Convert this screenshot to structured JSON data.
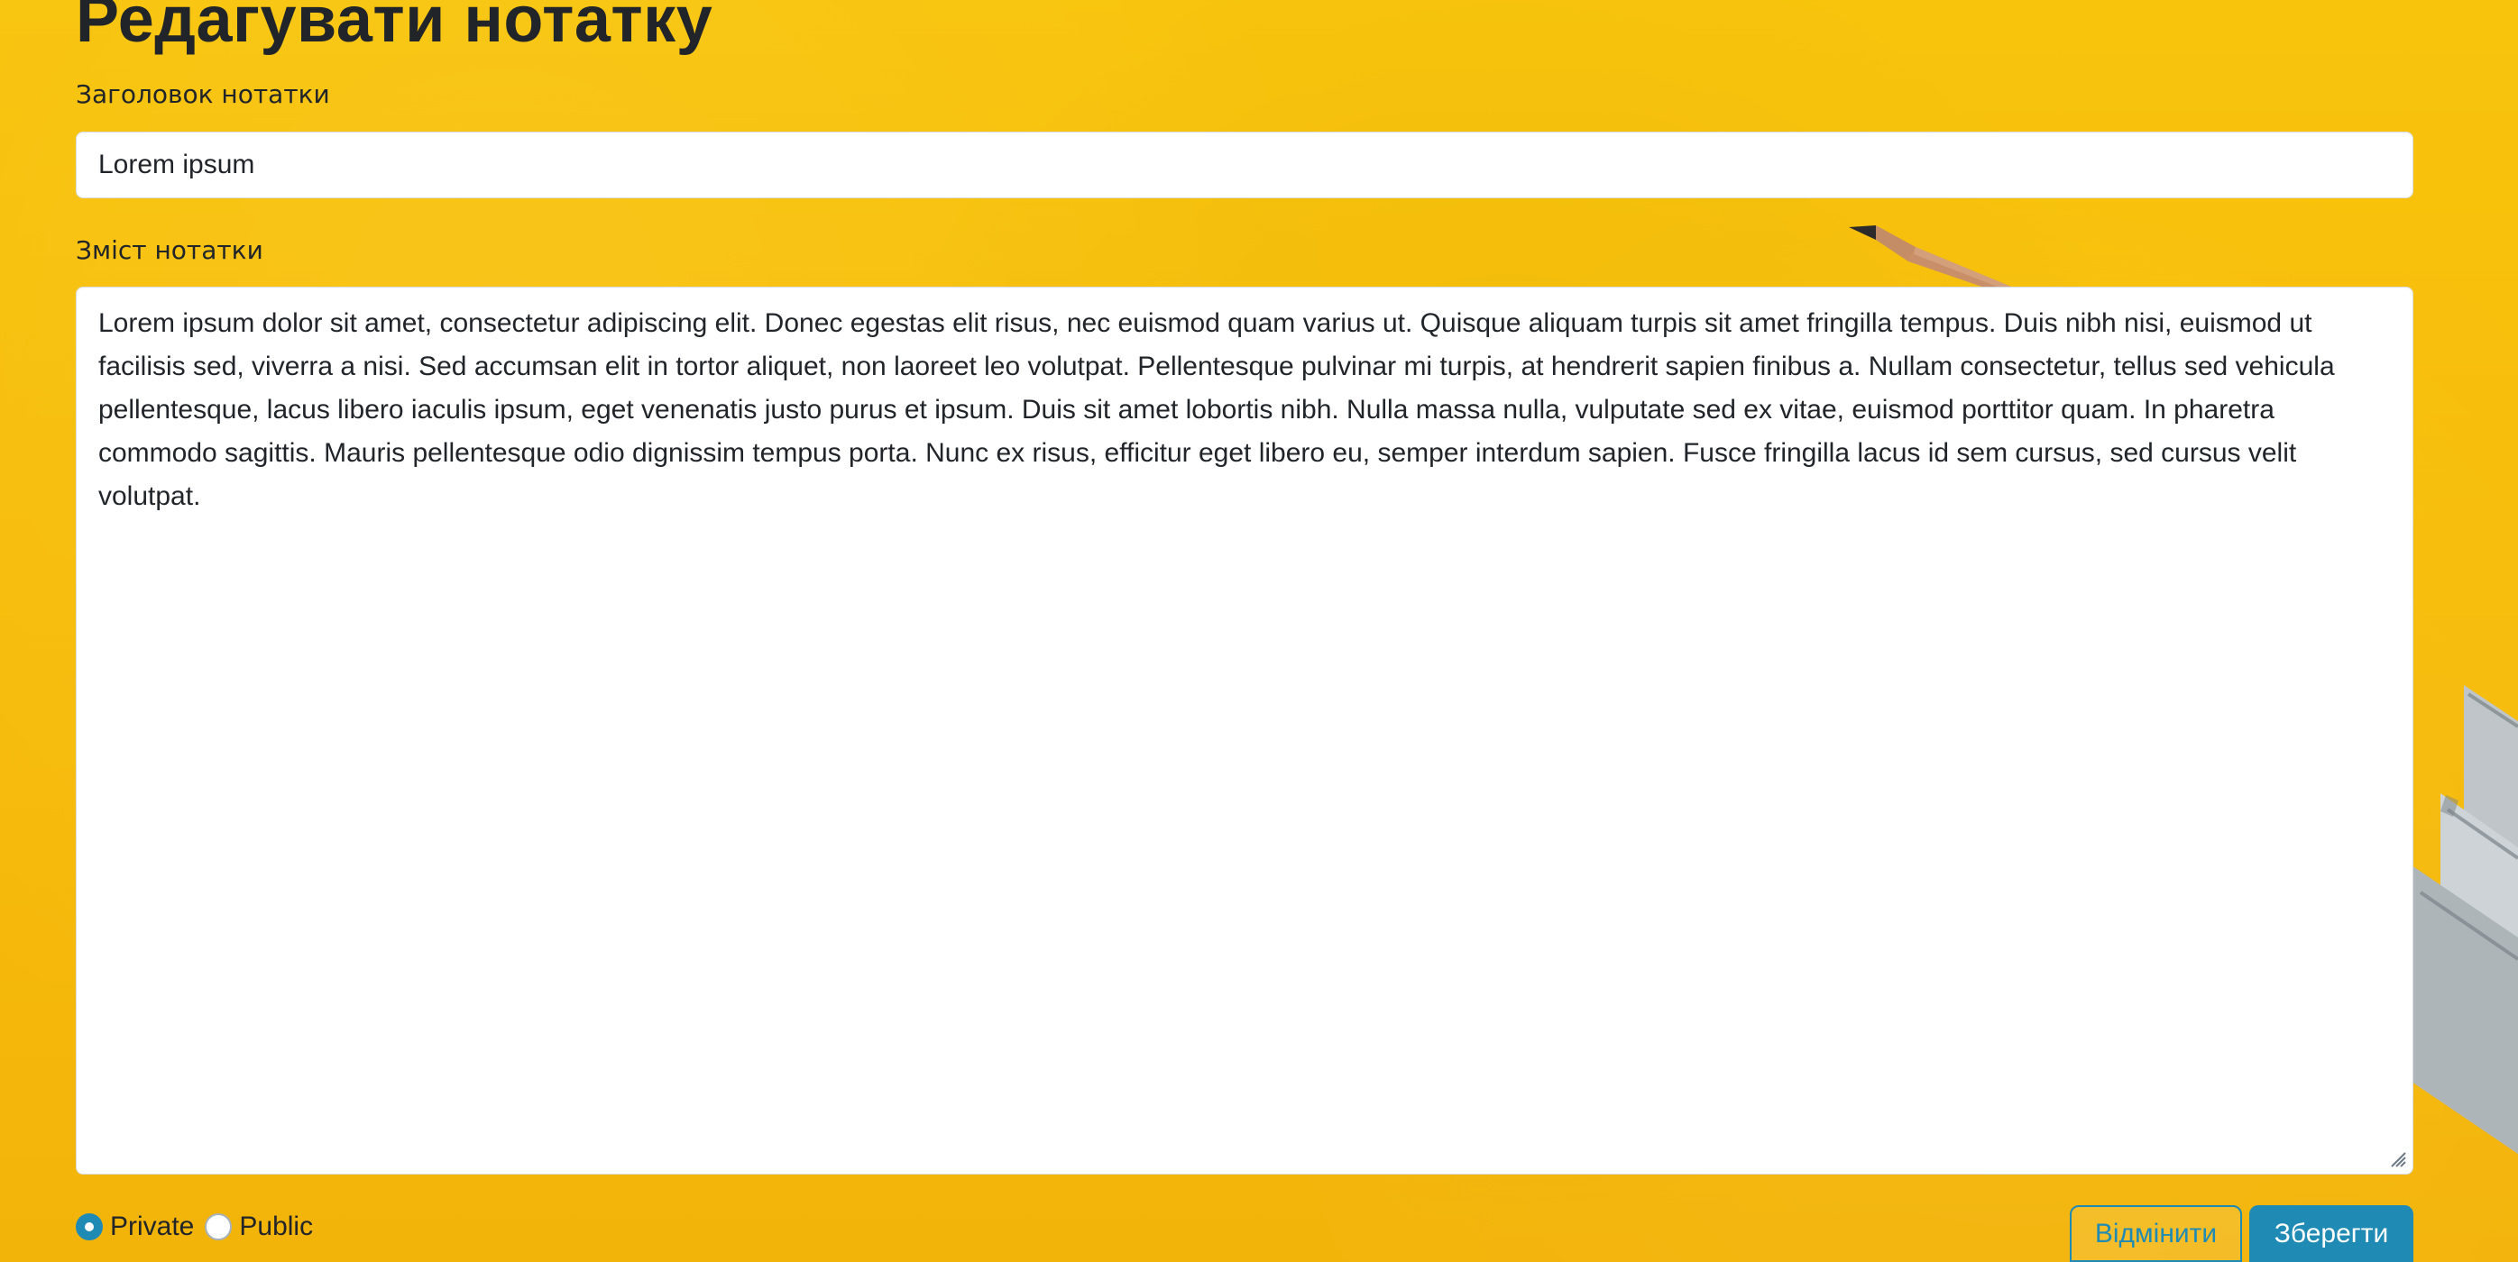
{
  "page": {
    "title": "Редагувати нотатку",
    "title_label": "Заголовок нотатки",
    "content_label": "Зміст нотатки"
  },
  "form": {
    "title_value": "Lorem ipsum",
    "content_value": "Lorem ipsum dolor sit amet, consectetur adipiscing elit. Donec egestas elit risus, nec euismod quam varius ut. Quisque aliquam turpis sit amet fringilla tempus. Duis nibh nisi, euismod ut facilisis sed, viverra a nisi. Sed accumsan elit in tortor aliquet, non laoreet leo volutpat. Pellentesque pulvinar mi turpis, at hendrerit sapien finibus a. Nullam consectetur, tellus sed vehicula pellentesque, lacus libero iaculis ipsum, eget venenatis justo purus et ipsum. Duis sit amet lobortis nibh. Nulla massa nulla, vulputate sed ex vitae, euismod porttitor quam. In pharetra commodo sagittis. Mauris pellentesque odio dignissim tempus porta. Nunc ex risus, efficitur eget libero eu, semper interdum sapien. Fusce fringilla lacus id sem cursus, sed cursus velit volutpat."
  },
  "visibility": {
    "private_label": "Private",
    "public_label": "Public"
  },
  "actions": {
    "cancel_label": "Відмінити",
    "save_label": "Зберегти"
  }
}
